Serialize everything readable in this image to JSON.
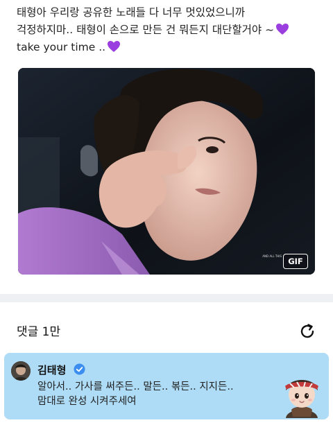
{
  "post": {
    "line1": "태형아 우리랑 공유한 노래들 다 너무 멋있었으니까",
    "line2": "걱정하지마.. 태형이 손으로 만든 건 뭐든지 대단할거야 ~",
    "line3": "take your time ..",
    "heart_emoji": "purple-heart",
    "heart_color": "#9b3ee0"
  },
  "media": {
    "badge_label": "GIF",
    "caption": "AND ALL THIS"
  },
  "comments": {
    "header": "댓글 1만",
    "refresh_icon": "refresh-icon",
    "pinned": {
      "author": "김태형",
      "verified_icon": "verified-badge-icon",
      "line1": "알아서.. 가사를 써주든.. 말든.. 볶든.. 지지든..",
      "line2": "맘대로 완성 시켜주세여",
      "background": "#aedcf7",
      "accent": "#3b8ef0"
    }
  }
}
